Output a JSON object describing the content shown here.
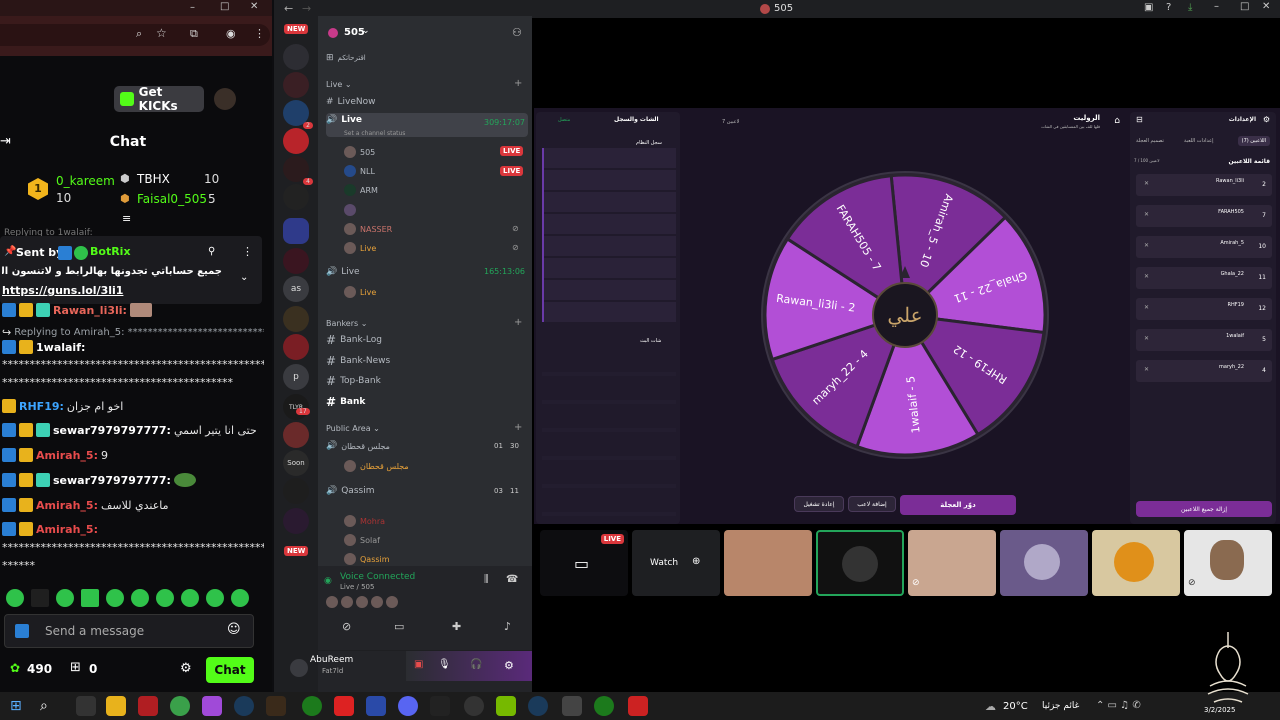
{
  "browser": {
    "get_kicks": "Get KICKs",
    "chat_title": "Chat",
    "leaderboard": [
      {
        "rank": "1",
        "name": "0_kareem",
        "count": "10"
      },
      {
        "rank": "",
        "name": "TBHX",
        "count": "10"
      },
      {
        "rank": "",
        "name": "Faisal0_505",
        "count": "5"
      }
    ],
    "replying_top": "Replying to 1walaif:",
    "pinned_sent_by": "Sent by",
    "pinned_user": "BotRix",
    "pinned_text": "جميع حساباتي تجدونها بهالرابط و لاتنسون الفولو",
    "pinned_link": "https://guns.lol/3li1",
    "messages": [
      {
        "user": "Rawan_li3li:",
        "text": "",
        "color": "#e8665a"
      },
      {
        "user": "",
        "text": "Replying to Amirah_5: ****************************",
        "color": "#9aa0a6"
      },
      {
        "user": "1walaif:",
        "text": "",
        "color": "#ffffff"
      },
      {
        "user": "",
        "text": "******************************************************",
        "color": "#e6e6e6"
      },
      {
        "user": "",
        "text": "******************************************",
        "color": "#e6e6e6"
      },
      {
        "user": "RHF19:",
        "text": "اخو ام جزان",
        "color": "#3da5ff"
      },
      {
        "user": "sewar7979797777:",
        "text": "حتى انا يتير اسمي",
        "color": "#ffffff"
      },
      {
        "user": "Amirah_5:",
        "text": "9",
        "color": "#e84c4c"
      },
      {
        "user": "sewar7979797777:",
        "text": "",
        "color": "#ffffff"
      },
      {
        "user": "Amirah_5:",
        "text": "ماعندي للاسف",
        "color": "#e84c4c"
      },
      {
        "user": "Amirah_5:",
        "text": "",
        "color": "#e84c4c"
      },
      {
        "user": "",
        "text": "******************************************************",
        "color": "#e6e6e6"
      },
      {
        "user": "",
        "text": "******",
        "color": "#e6e6e6"
      }
    ],
    "send_placeholder": "Send a message",
    "kicks_count": "490",
    "gifts_count": "0",
    "chat_button": "Chat"
  },
  "discord": {
    "window_title": "505",
    "server_name": "505",
    "server_tagline": "اقترحاتكم",
    "categories": {
      "live": "Live",
      "bankers": "Bankers",
      "public": "Public Area"
    },
    "channels": {
      "livenow": "LiveNow",
      "live1": "Live",
      "live1_timer": "309:17:07",
      "live1_status": "Set a channel status",
      "live2": "Live",
      "live2_timer": "165:13:06",
      "bank_log": "Bank-Log",
      "bank_news": "Bank-News",
      "top_bank": "Top-Bank",
      "bank": "Bank",
      "majlis": "مجلس قحطان",
      "majlis_count": "01",
      "majlis_limit": "30",
      "qassim": "Qassim",
      "qassim_count": "03",
      "qassim_limit": "11"
    },
    "voice_users": {
      "u505": "505",
      "nll": "NLL",
      "arm": "ARM",
      "nasser": "NASSER",
      "live_user": "Live",
      "live_user2": "Live",
      "majlis_user": "مجلس قحطان",
      "mohra": "Mohra",
      "solaf": "Solaf",
      "qassim_user": "Qassim"
    },
    "live_badge": "LIVE",
    "new_badge": "NEW",
    "server_labels": [
      "as",
      "p",
      "TLYR",
      "Soon"
    ],
    "server_notifs": [
      "2",
      "4",
      "17"
    ],
    "voice_connected": "Voice Connected",
    "voice_channel": "Live / 505",
    "user_name": "AbuReem",
    "user_tag": "Fat7ld"
  },
  "game": {
    "chat_panel_title": "الشات والسجل",
    "chat_panel_sub": "متصل",
    "system_log_title": "سجل النظام",
    "bot_chat_title": "شات البث",
    "roulette_title": "الروليت",
    "roulette_sub": "قلها للف بين المتسابقين في الشات",
    "players_info": "7 لاعبين",
    "settings_title": "الإعدادات",
    "tabs": [
      "اللاعبين (7)",
      "إعدادات اللعبة",
      "تصميم العجلة"
    ],
    "players_header": "قائمة اللاعبين",
    "players_count": "7 / 100 لاعبين",
    "players": [
      {
        "name": "Rawan_li3li",
        "num": "2"
      },
      {
        "name": "FARAH505",
        "num": "7"
      },
      {
        "name": "Amirah_5",
        "num": "10"
      },
      {
        "name": "Ghala_22",
        "num": "11"
      },
      {
        "name": "RHF19",
        "num": "12"
      },
      {
        "name": "1walaif",
        "num": "5"
      },
      {
        "name": "maryh_22",
        "num": "4"
      }
    ],
    "wheel_segments": [
      "Amirah_5 - 10",
      "Ghala_22 - 11",
      "RHF19 - 12",
      "1walaif - 5",
      "maryh_22 - 4",
      "Rawan_li3li - 2",
      "FARAH505 - 7"
    ],
    "wheel_center": "علي",
    "btn_spin": "دوّر العجلة",
    "btn_add": "إضافة لاعب",
    "btn_restart": "إعادة تشغيل",
    "btn_remove_all": "إزالة جميع اللاعبين",
    "watch_label": "Watch",
    "tile_live": "LIVE"
  },
  "taskbar": {
    "weather": "20°C",
    "weather_text": "غائم جزئيا",
    "date": "3/2/2025"
  },
  "colors": {
    "kick_green": "#53fc18",
    "wheel_purple": "#7b2d97",
    "wheel_light": "#b24fd6"
  }
}
